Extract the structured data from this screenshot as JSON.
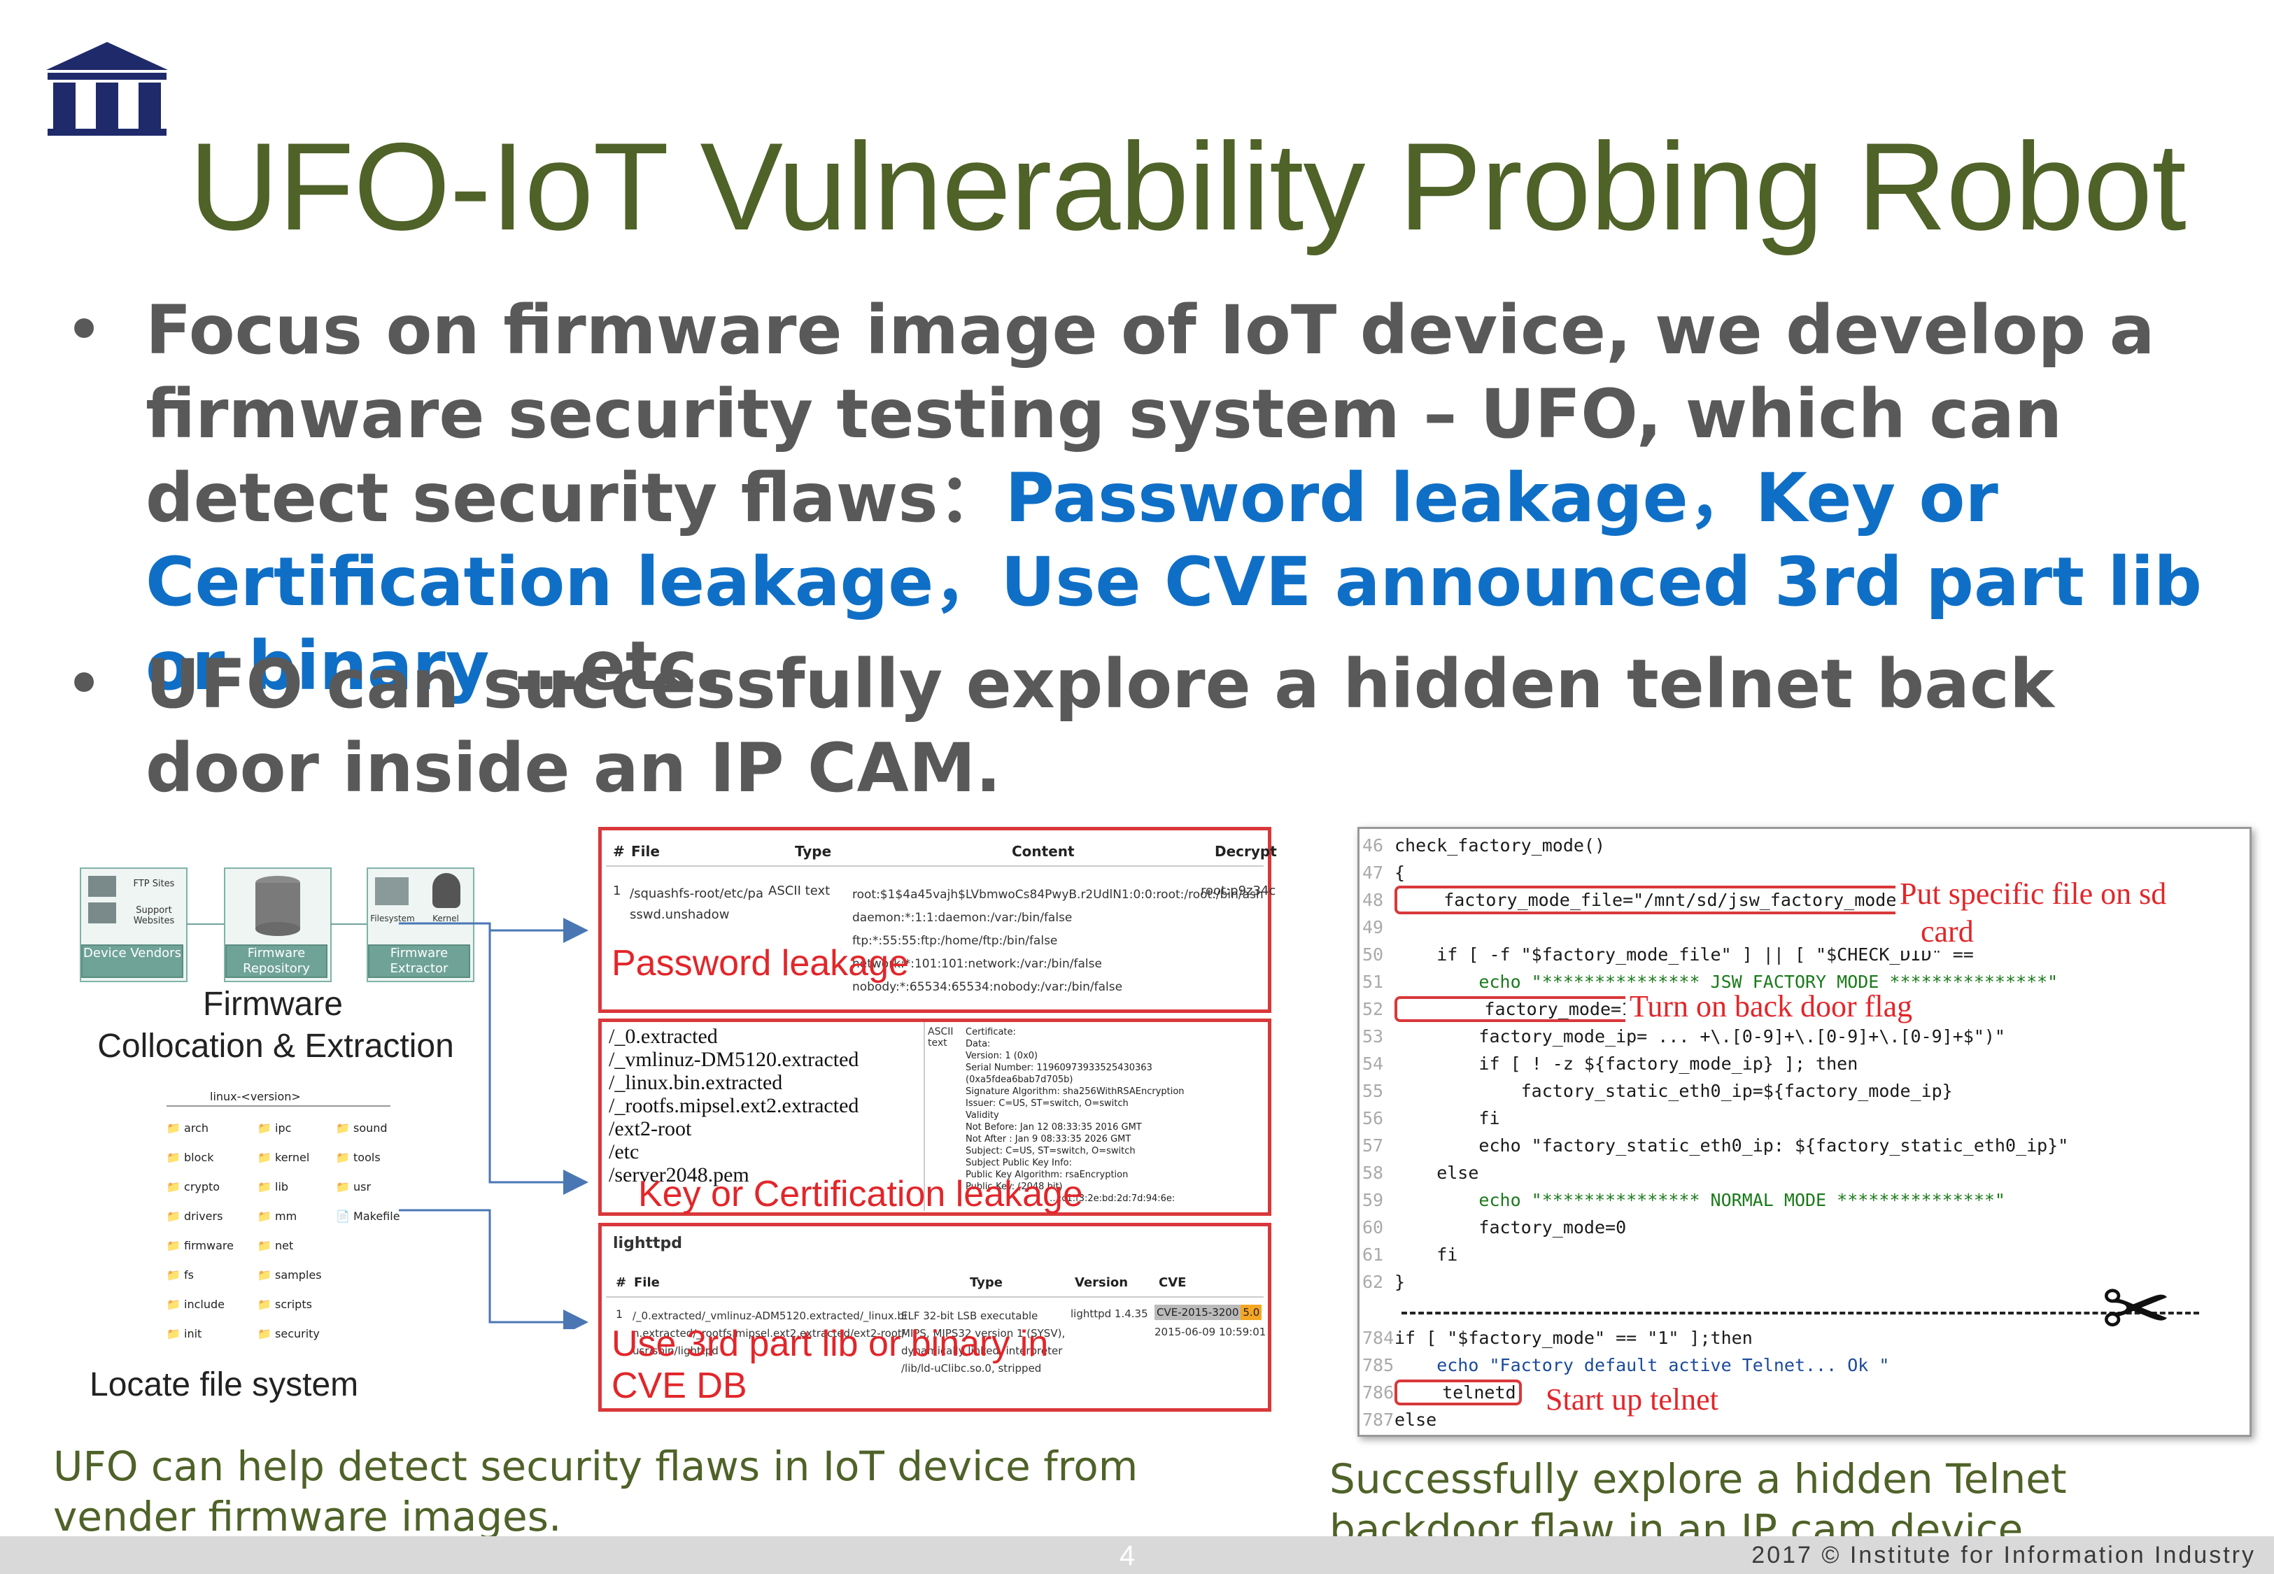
{
  "title": "UFO-IoT Vulnerability Probing Robot",
  "logo_icon": "institute-columns-logo-icon",
  "bullets": [
    {
      "lead": "Focus on firmware image of IoT device, we develop a firmware security testing system – UFO, which can detect security flaws：",
      "highlight_1": "Password leakage",
      "sep_1": "，",
      "highlight_2": "Key or Certification leakage",
      "sep_2": "，",
      "highlight_3": "Use CVE announced 3rd part lib or binary",
      "tail": " …etc."
    },
    {
      "text": "UFO can successfully explore a hidden telnet back door inside an IP CAM."
    }
  ],
  "left_diagram": {
    "boxes": [
      {
        "label": "Device Vendors",
        "sub": [
          "FTP Sites",
          "Support Websites"
        ]
      },
      {
        "label": "Firmware Repository"
      },
      {
        "label": "Firmware Extractor",
        "sub": [
          "Filesystem",
          "Kernel"
        ]
      }
    ],
    "heading_1": "Firmware",
    "heading_2": "Collocation & Extraction",
    "tree_root": "linux-<version>",
    "tree_cols": [
      [
        "arch",
        "block",
        "crypto",
        "drivers",
        "firmware",
        "fs",
        "include",
        "init"
      ],
      [
        "ipc",
        "kernel",
        "lib",
        "mm",
        "net",
        "samples",
        "scripts",
        "security"
      ],
      [
        "sound",
        "tools",
        "usr",
        "Makefile"
      ]
    ],
    "locate_label": "Locate file system"
  },
  "panel_password": {
    "headers": [
      "#",
      "File",
      "Type",
      "Content",
      "Decrypt"
    ],
    "row_num": "1",
    "file": "/squashfs-root/etc/passwd.unshadow",
    "type": "ASCII text",
    "content_lines": [
      "root:$1$4a45vajh$LVbmwoCs84PwyB.r2UdlN1:0:0:root:/root:/bin/ash",
      "daemon:*:1:1:daemon:/var:/bin/false",
      "ftp:*:55:55:ftp:/home/ftp:/bin/false",
      "network:*:101:101:network:/var:/bin/false",
      "nobody:*:65534:65534:nobody:/var:/bin/false"
    ],
    "decrypt": "root:p9z34c",
    "label": "Password leakage"
  },
  "panel_key": {
    "paths": [
      "/_0.extracted",
      "/_vmlinuz-DM5120.extracted",
      "/_linux.bin.extracted",
      "/_rootfs.mipsel.ext2.extracted",
      "/ext2-root",
      "/etc",
      "/server2048.pem"
    ],
    "type_col": "ASCII text",
    "cert_lines": [
      "Certificate:",
      "Data:",
      "Version: 1 (0x0)",
      "Serial Number: 11960973933525430363",
      "(0xa5fdea6bab7d705b)",
      "Signature Algorithm: sha256WithRSAEncryption",
      "Issuer: C=US, ST=switch, O=switch",
      "Validity",
      "Not Before: Jan 12 08:33:35 2016 GMT",
      "Not After : Jan 9 08:33:35 2026 GMT",
      "Subject: C=US, ST=switch, O=switch",
      "Subject Public Key Info:",
      "Public Key Algorithm: rsaEncryption",
      "Public-Key: (2048 bit)",
      "…:c1:f3:2e:bd:2d:7d:94:6e:"
    ],
    "label": "Key or Certification leakage"
  },
  "panel_cve": {
    "title": "lighttpd",
    "headers": [
      "#",
      "File",
      "Type",
      "Version",
      "CVE"
    ],
    "row_num": "1",
    "file": "/_0.extracted/_vmlinuz-ADM5120.extracted/_linux.bin.extracted/_rootfs.mipsel.ext2.extracted/ext2-root/usr/sbin/lighttpd",
    "type": "ELF 32-bit LSB executable MIPS, MIPS32 version 1 (SYSV), dynamically linked, interpreter /lib/ld-uClibc.so.0, stripped",
    "version": "lighttpd 1.4.35",
    "cve_id": "CVE-2015-3200",
    "cve_score": "5.0",
    "cve_date": "2015-06-09 10:59:01",
    "label_1": "Use 3rd part lib or binary in",
    "label_2": "CVE DB"
  },
  "code_panel": {
    "lines": [
      {
        "n": "46",
        "t": "check_factory_mode()"
      },
      {
        "n": "47",
        "t": "{"
      },
      {
        "n": "48",
        "t": "    factory_mode_file=\"/mnt/sd/jsw_factory_mode.txt\""
      },
      {
        "n": "49",
        "t": ""
      },
      {
        "n": "50",
        "t": "    if [ -f \"$factory_mode_file\" ] || [ \"$CHECK_DID\" =="
      },
      {
        "n": "51",
        "t": "        echo \"*************** JSW FACTORY MODE ***************\""
      },
      {
        "n": "52",
        "t": "        factory_mode=1"
      },
      {
        "n": "53",
        "t": "        factory_mode_ip= ... +\\.[0-9]+\\.[0-9]+\\.[0-9]+$\")\""
      },
      {
        "n": "54",
        "t": "        if [ ! -z ${factory_mode_ip} ]; then"
      },
      {
        "n": "55",
        "t": "            factory_static_eth0_ip=${factory_mode_ip}"
      },
      {
        "n": "56",
        "t": "        fi"
      },
      {
        "n": "57",
        "t": "        echo \"factory_static_eth0_ip: ${factory_static_eth0_ip}\""
      },
      {
        "n": "58",
        "t": "    else"
      },
      {
        "n": "59",
        "t": "        echo \"*************** NORMAL MODE ***************\""
      },
      {
        "n": "60",
        "t": "        factory_mode=0"
      },
      {
        "n": "61",
        "t": "    fi"
      },
      {
        "n": "62",
        "t": "}"
      }
    ],
    "lines_2": [
      {
        "n": "784",
        "t": "if [ \"$factory_mode\" == \"1\" ];then"
      },
      {
        "n": "785",
        "t": "    echo \"Factory default active Telnet... Ok \""
      },
      {
        "n": "786",
        "t": "    telnetd"
      },
      {
        "n": "787",
        "t": "else"
      }
    ],
    "annot_sd_1": "Put specific  file  on sd",
    "annot_sd_2": "card",
    "annot_flag": "Turn on back door flag",
    "annot_telnet": "Start up telnet",
    "scissors_icon": "✂"
  },
  "caption_left": "UFO can help detect security flaws in IoT device from vender firmware images.",
  "caption_right": "Successfully explore a hidden Telnet  backdoor flaw in an IP cam device",
  "footer": {
    "slide_number": "4",
    "copyright": "2017 © Institute for Information Industry"
  }
}
